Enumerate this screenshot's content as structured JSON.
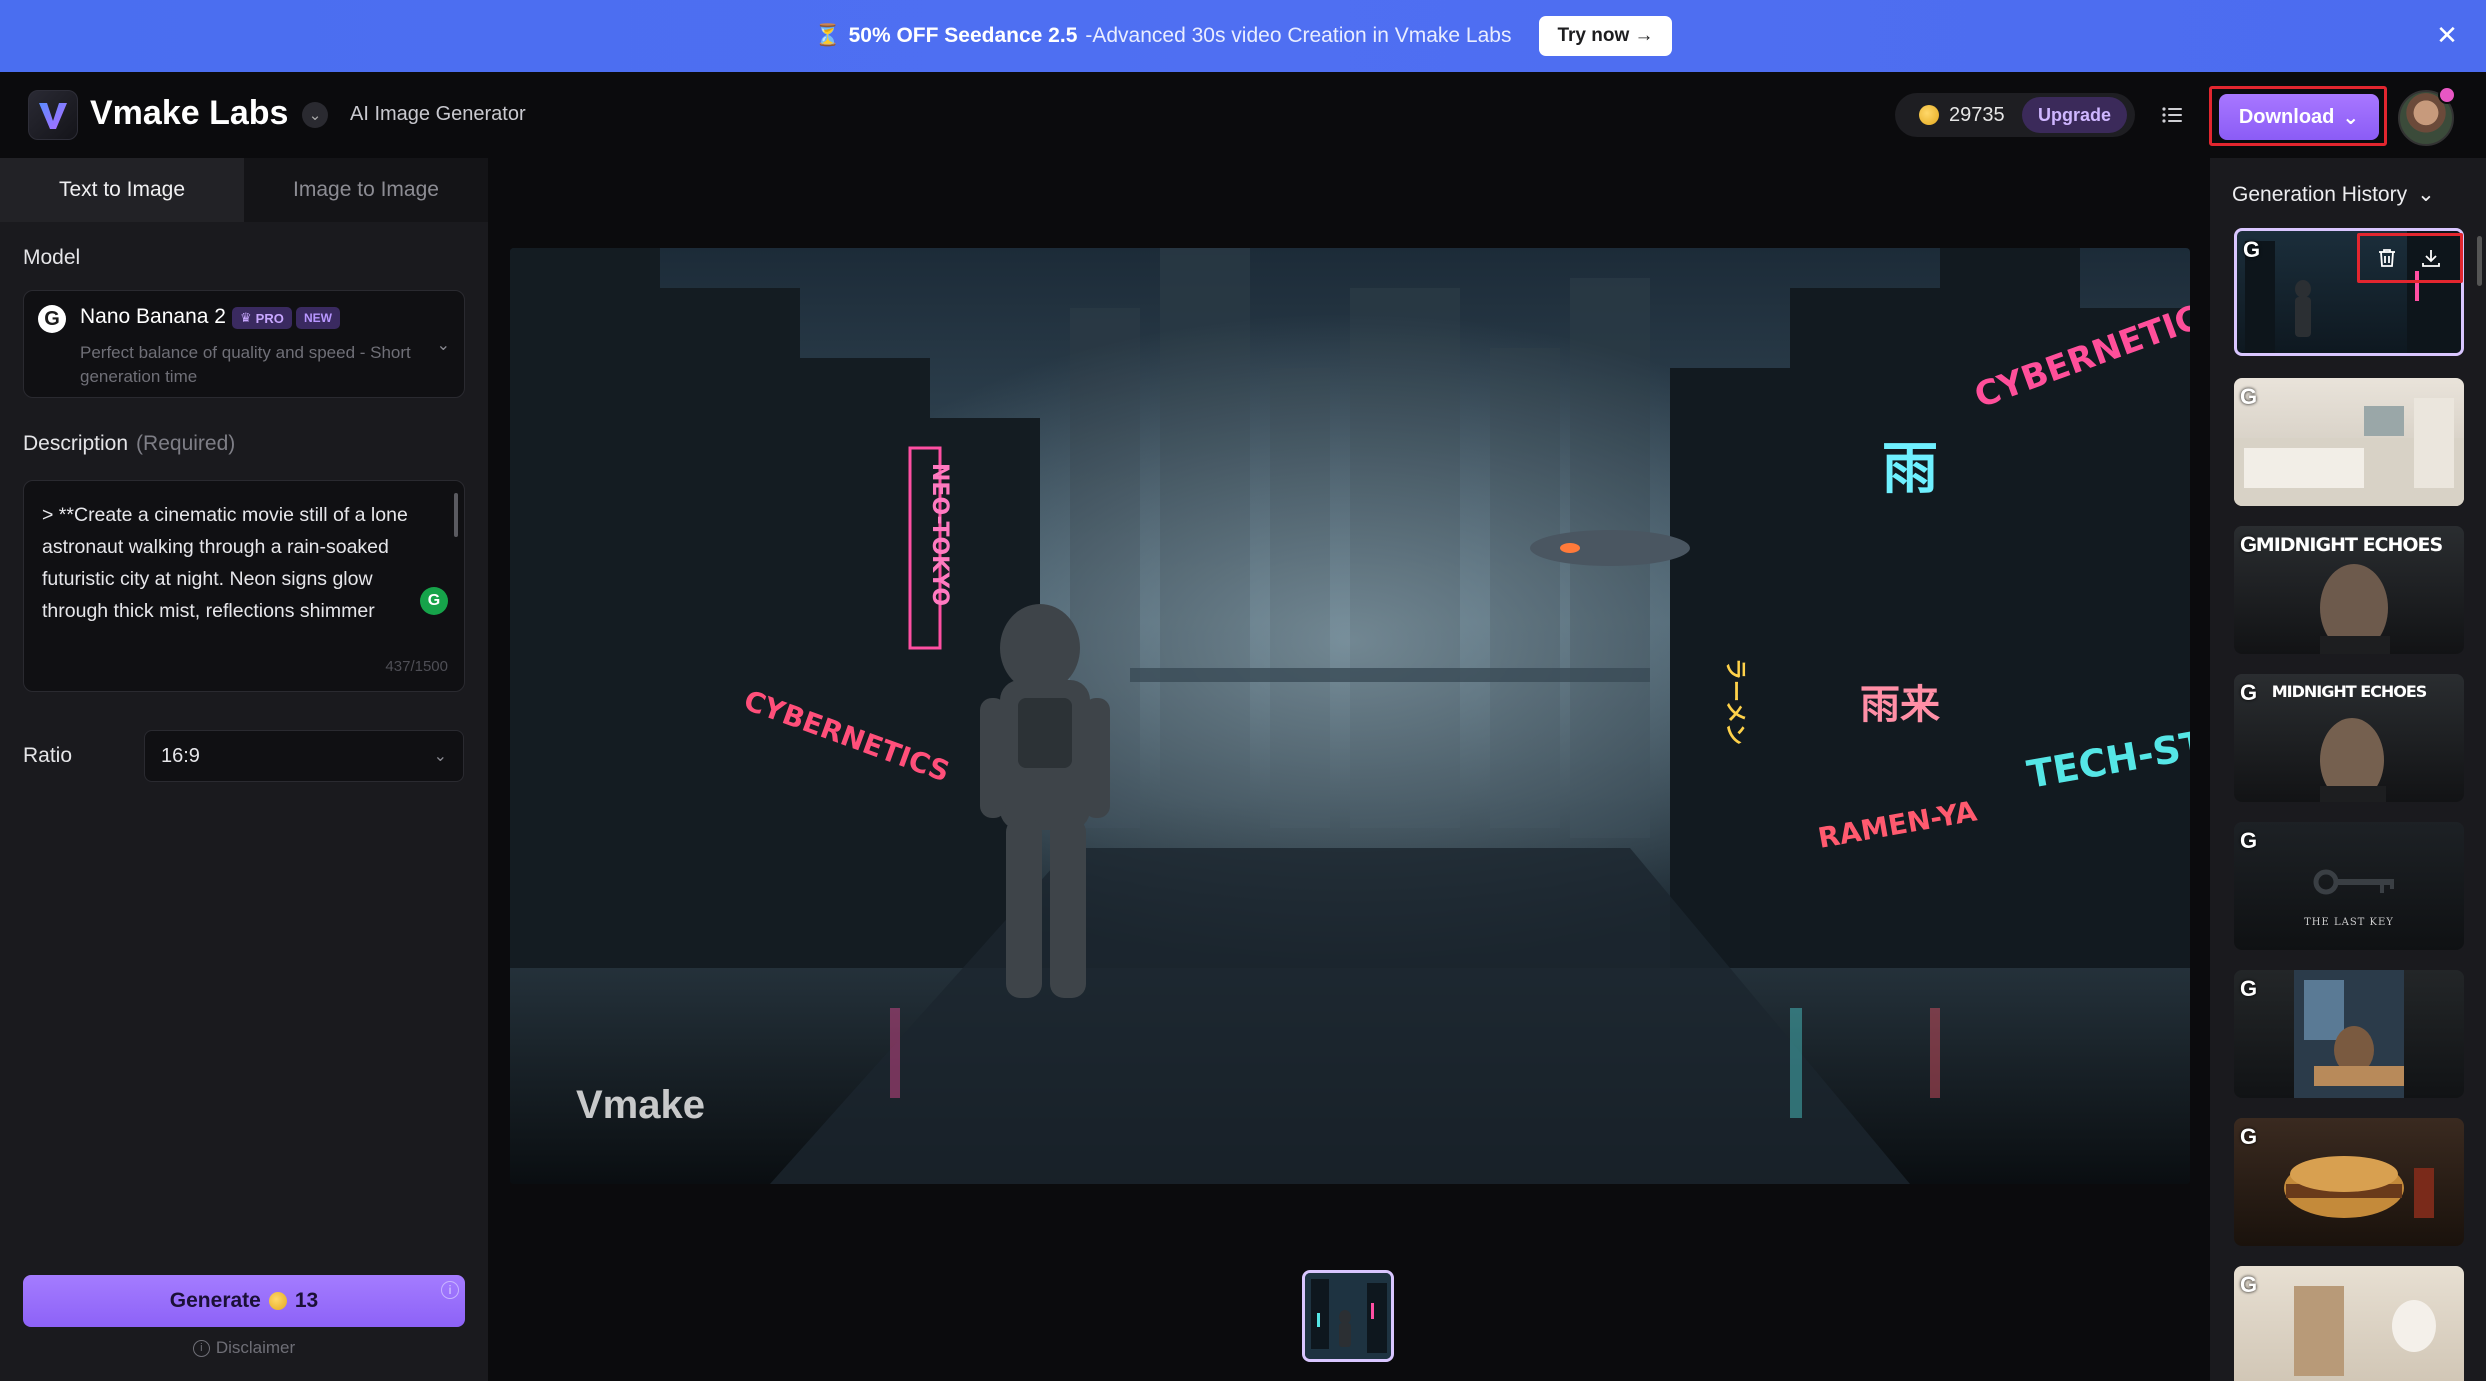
{
  "banner": {
    "emoji": "⏳",
    "highlight": "50% OFF Seedance 2.5",
    "text": " -Advanced 30s video Creation in Vmake Labs",
    "cta": "Try now →",
    "close_icon": "close-icon"
  },
  "header": {
    "brand": "Vmake Labs",
    "subtitle": "AI Image Generator",
    "credits": "29735",
    "upgrade": "Upgrade",
    "download": "Download",
    "colors": {
      "accent": "#8b5cf6",
      "banner": "#4f6ff2",
      "highlight_box": "#e3262f"
    }
  },
  "left_panel": {
    "tabs": [
      {
        "label": "Text to Image",
        "active": true
      },
      {
        "label": "Image to Image",
        "active": false
      }
    ],
    "model_label": "Model",
    "model": {
      "name": "Nano Banana 2",
      "badge_pro": "PRO",
      "badge_new": "NEW",
      "description": "Perfect balance of quality and speed - Short generation time"
    },
    "description_label": "Description",
    "description_required": "(Required)",
    "description_value": "> **Create a cinematic movie still of a lone astronaut walking through a rain-soaked futuristic city at night. Neon signs glow through thick mist, reflections shimmer",
    "description_count": "437/1500",
    "ratio_label": "Ratio",
    "ratio_value": "16:9",
    "generate_label": "Generate",
    "generate_cost": "13",
    "disclaimer": "Disclaimer"
  },
  "main": {
    "watermark": "Vmake",
    "signs": [
      "CYBERNETICS",
      "NEO-TOKYO",
      "TECH-STREET",
      "RAMEN-YA",
      "雨",
      "雨来",
      "ラーメン",
      "CYBERNETICS"
    ]
  },
  "history": {
    "title": "Generation History",
    "items": [
      {
        "label": "",
        "caption": ""
      },
      {
        "label": "",
        "caption": ""
      },
      {
        "label": "MIDNIGHT ECHOES",
        "caption": ""
      },
      {
        "label": "MIDNIGHT ECHOES",
        "caption": ""
      },
      {
        "label": "",
        "caption": "THE LAST KEY"
      },
      {
        "label": "",
        "caption": ""
      },
      {
        "label": "",
        "caption": ""
      },
      {
        "label": "",
        "caption": ""
      }
    ]
  }
}
